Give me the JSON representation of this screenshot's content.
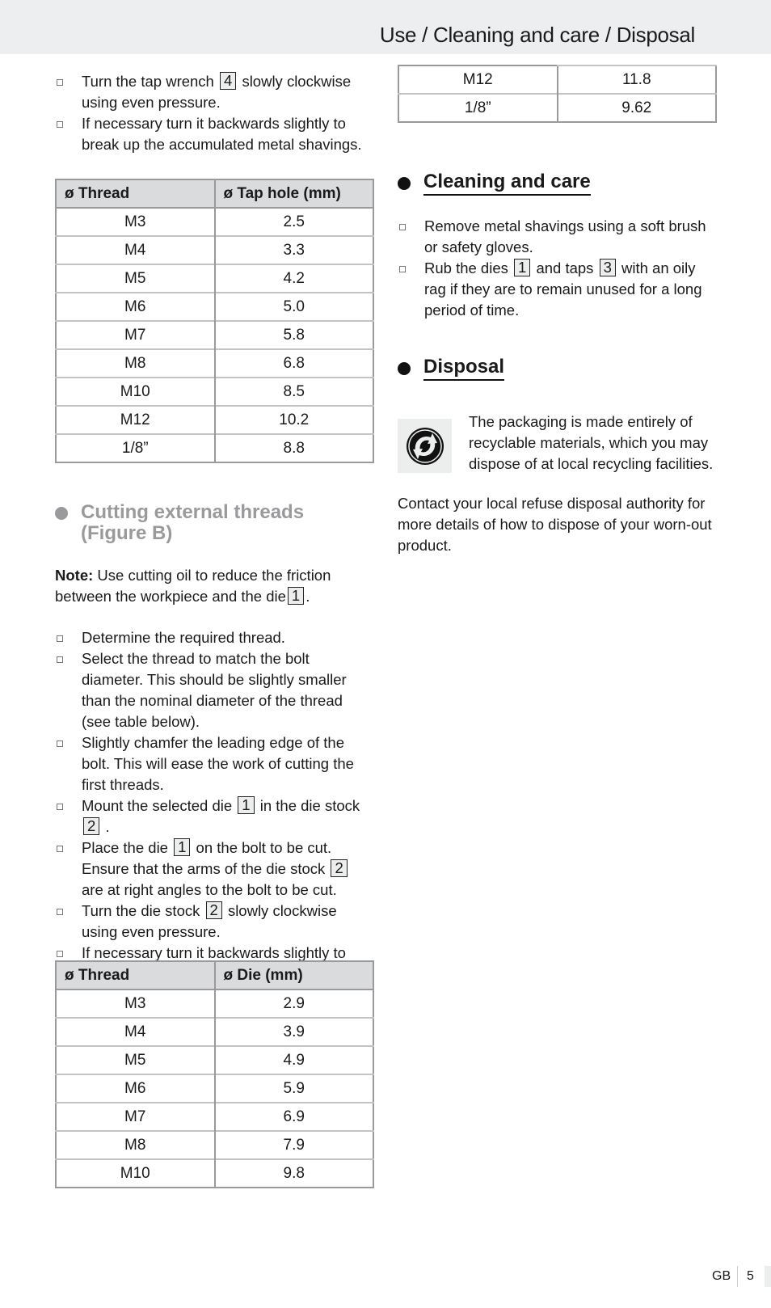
{
  "header": {
    "title": "Use / Cleaning and care / Disposal"
  },
  "left": {
    "intro_bullets": [
      {
        "pre": "Turn the tap wrench",
        "ref": "4",
        "post": "slowly clockwise using even pressure."
      },
      {
        "pre": "If necessary turn it backwards slightly to break up the accumulated metal shavings.",
        "ref": null,
        "post": ""
      }
    ],
    "tap_table": {
      "headers": [
        "ø Thread",
        "ø Tap hole (mm)"
      ],
      "rows": [
        [
          "M3",
          "2.5"
        ],
        [
          "M4",
          "3.3"
        ],
        [
          "M5",
          "4.2"
        ],
        [
          "M6",
          "5.0"
        ],
        [
          "M7",
          "5.8"
        ],
        [
          "M8",
          "6.8"
        ],
        [
          "M10",
          "8.5"
        ],
        [
          "M12",
          "10.2"
        ],
        [
          "1/8”",
          "8.8"
        ]
      ]
    },
    "external_section": {
      "title_line1": "Cutting external threads",
      "title_line2": "(Figure B)"
    },
    "note": {
      "label": "Note:",
      "text": "Use cutting oil to reduce the friction between the workpiece and the die",
      "ref": "1",
      "tail": "."
    },
    "steps": [
      {
        "parts": [
          {
            "t": "Determine the required thread."
          }
        ]
      },
      {
        "parts": [
          {
            "t": "Select the thread to match the bolt diameter. This should be slightly smaller than the nominal diameter of the thread (see table below)."
          }
        ]
      },
      {
        "parts": [
          {
            "t": "Slightly chamfer the leading edge of the bolt. This will ease the work of cutting the first threads."
          }
        ]
      },
      {
        "parts": [
          {
            "t": "Mount the selected die"
          },
          {
            "r": "1"
          },
          {
            "t": "in the die stock"
          },
          {
            "r": "2"
          },
          {
            "t": "."
          }
        ]
      },
      {
        "parts": [
          {
            "t": "Place the die"
          },
          {
            "r": "1"
          },
          {
            "t": "on the bolt to be cut. Ensure that the arms of the die stock"
          },
          {
            "r": "2"
          },
          {
            "t": "are at right angles to the bolt to be cut."
          }
        ]
      },
      {
        "parts": [
          {
            "t": "Turn the die stock"
          },
          {
            "r": "2"
          },
          {
            "t": "slowly clockwise using even pressure."
          }
        ]
      },
      {
        "parts": [
          {
            "t": "If necessary turn it backwards slightly to break up the accumulated metal shavings."
          }
        ]
      }
    ],
    "die_table": {
      "headers": [
        "ø Thread",
        "ø Die (mm)"
      ],
      "rows": [
        [
          "M3",
          "2.9"
        ],
        [
          "M4",
          "3.9"
        ],
        [
          "M5",
          "4.9"
        ],
        [
          "M6",
          "5.9"
        ],
        [
          "M7",
          "6.9"
        ],
        [
          "M8",
          "7.9"
        ],
        [
          "M10",
          "9.8"
        ]
      ]
    }
  },
  "right": {
    "continued_table": {
      "rows": [
        [
          "M12",
          "11.8"
        ],
        [
          "1/8”",
          "9.62"
        ]
      ]
    },
    "cleaning": {
      "title": "Cleaning and care",
      "bullets": [
        {
          "parts": [
            {
              "t": "Remove metal shavings using a soft brush or safety gloves."
            }
          ]
        },
        {
          "parts": [
            {
              "t": "Rub the dies"
            },
            {
              "r": "1"
            },
            {
              "t": "and taps"
            },
            {
              "r": "3"
            },
            {
              "t": "with an oily rag if they are to remain unused for a long period of time."
            }
          ]
        }
      ]
    },
    "disposal": {
      "title": "Disposal",
      "icon": "green-dot-recycling-icon",
      "packaging_text": "The packaging is made entirely of recyclable materials, which you may dispose of at local recycling facilities.",
      "contact_text": "Contact your local refuse disposal authority for more details of how to dispose of your worn-out product."
    }
  },
  "footer": {
    "lang": "GB",
    "page": "5"
  }
}
